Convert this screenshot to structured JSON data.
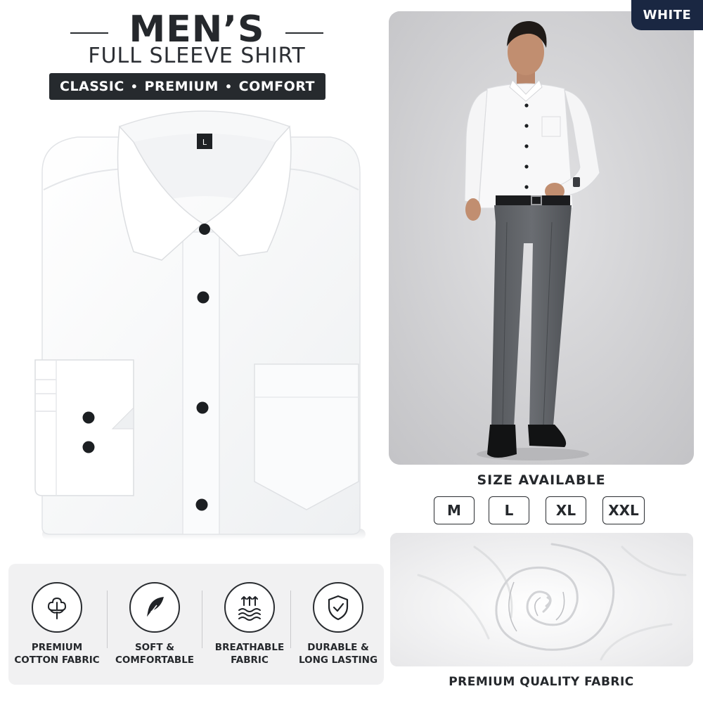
{
  "header": {
    "title": "MEN’S",
    "subtitle": "FULL SLEEVE SHIRT",
    "tags": [
      "CLASSIC",
      "PREMIUM",
      "COMFORT"
    ],
    "tag_separator": "•"
  },
  "product": {
    "color_badge": "WHITE",
    "collar_size_tag": "L"
  },
  "sizes": {
    "title": "SIZE AVAILABLE",
    "options": [
      "M",
      "L",
      "XL",
      "XXL"
    ]
  },
  "fabric": {
    "caption": "PREMIUM QUALITY FABRIC"
  },
  "features": [
    {
      "icon": "cotton-flower-icon",
      "line1": "PREMIUM",
      "line2": "COTTON FABRIC"
    },
    {
      "icon": "feather-icon",
      "line1": "SOFT &",
      "line2": "COMFORTABLE"
    },
    {
      "icon": "breathable-waves-icon",
      "line1": "BREATHABLE",
      "line2": "FABRIC"
    },
    {
      "icon": "shield-check-icon",
      "line1": "DURABLE &",
      "line2": "LONG LASTING"
    }
  ],
  "colors": {
    "dark_text": "#25282c",
    "tag_bar": "#262a2e",
    "badge_navy": "#1a2742",
    "panel_bg": "#f1f1f2"
  }
}
